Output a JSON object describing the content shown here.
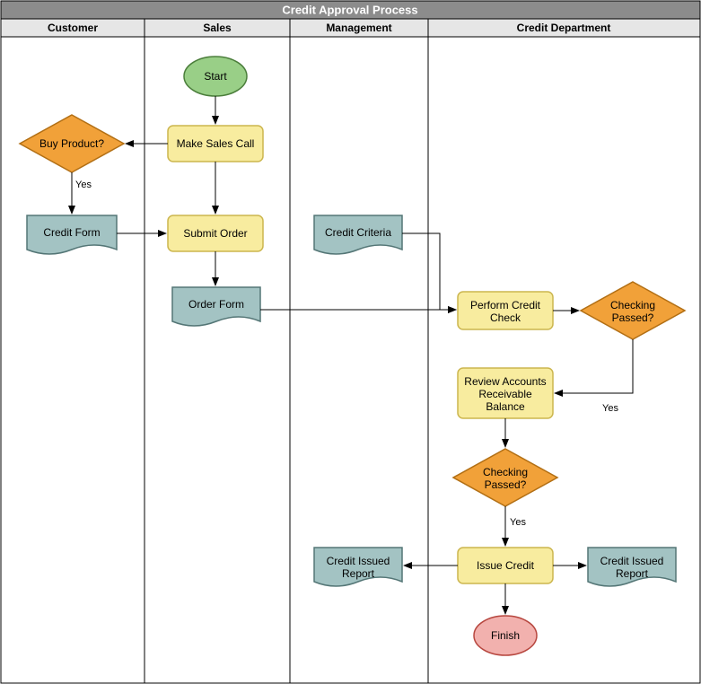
{
  "title": "Credit Approval Process",
  "lanes": [
    {
      "name": "Customer"
    },
    {
      "name": "Sales"
    },
    {
      "name": "Management"
    },
    {
      "name": "Credit Department"
    }
  ],
  "nodes": {
    "start": {
      "label": "Start"
    },
    "make_call": {
      "label": "Make Sales Call"
    },
    "buy": {
      "label": "Buy Product?"
    },
    "credit_form": {
      "label": "Credit Form"
    },
    "submit": {
      "label": "Submit Order"
    },
    "order_form": {
      "label": "Order Form"
    },
    "criteria": {
      "label": "Credit Criteria"
    },
    "perform": {
      "label1": "Perform Credit",
      "label2": "Check"
    },
    "check1": {
      "label1": "Checking",
      "label2": "Passed?"
    },
    "review": {
      "label1": "Review Accounts",
      "label2": "Receivable",
      "label3": "Balance"
    },
    "check2": {
      "label1": "Checking",
      "label2": "Passed?"
    },
    "issue": {
      "label": "Issue Credit"
    },
    "finish": {
      "label": "Finish"
    },
    "report_left": {
      "label1": "Credit Issued",
      "label2": "Report"
    },
    "report_right": {
      "label1": "Credit Issued",
      "label2": "Report"
    }
  },
  "edges": {
    "yes1": "Yes",
    "yes2": "Yes",
    "yes3": "Yes"
  },
  "chart_data": {
    "type": "swimlane-flowchart",
    "title": "Credit Approval Process",
    "lanes": [
      "Customer",
      "Sales",
      "Management",
      "Credit Department"
    ],
    "shapes": [
      {
        "id": "start",
        "lane": "Sales",
        "type": "terminator",
        "label": "Start"
      },
      {
        "id": "make_call",
        "lane": "Sales",
        "type": "process",
        "label": "Make Sales Call"
      },
      {
        "id": "buy",
        "lane": "Customer",
        "type": "decision",
        "label": "Buy Product?"
      },
      {
        "id": "credit_form",
        "lane": "Customer",
        "type": "document",
        "label": "Credit Form"
      },
      {
        "id": "submit",
        "lane": "Sales",
        "type": "process",
        "label": "Submit Order"
      },
      {
        "id": "order_form",
        "lane": "Sales",
        "type": "document",
        "label": "Order Form"
      },
      {
        "id": "criteria",
        "lane": "Management",
        "type": "document",
        "label": "Credit Criteria"
      },
      {
        "id": "perform",
        "lane": "Credit Department",
        "type": "process",
        "label": "Perform Credit Check"
      },
      {
        "id": "check1",
        "lane": "Credit Department",
        "type": "decision",
        "label": "Checking Passed?"
      },
      {
        "id": "review",
        "lane": "Credit Department",
        "type": "process",
        "label": "Review Accounts Receivable Balance"
      },
      {
        "id": "check2",
        "lane": "Credit Department",
        "type": "decision",
        "label": "Checking Passed?"
      },
      {
        "id": "issue",
        "lane": "Credit Department",
        "type": "process",
        "label": "Issue Credit"
      },
      {
        "id": "report_left",
        "lane": "Management",
        "type": "document",
        "label": "Credit Issued Report"
      },
      {
        "id": "report_right",
        "lane": "Credit Department",
        "type": "document",
        "label": "Credit Issued Report"
      },
      {
        "id": "finish",
        "lane": "Credit Department",
        "type": "terminator",
        "label": "Finish"
      }
    ],
    "edges": [
      {
        "from": "start",
        "to": "make_call"
      },
      {
        "from": "make_call",
        "to": "buy"
      },
      {
        "from": "buy",
        "to": "credit_form",
        "label": "Yes"
      },
      {
        "from": "make_call",
        "to": "submit"
      },
      {
        "from": "credit_form",
        "to": "submit"
      },
      {
        "from": "submit",
        "to": "order_form"
      },
      {
        "from": "order_form",
        "to": "perform"
      },
      {
        "from": "criteria",
        "to": "perform"
      },
      {
        "from": "perform",
        "to": "check1"
      },
      {
        "from": "check1",
        "to": "review",
        "label": "Yes"
      },
      {
        "from": "review",
        "to": "check2"
      },
      {
        "from": "check2",
        "to": "issue",
        "label": "Yes"
      },
      {
        "from": "issue",
        "to": "report_left"
      },
      {
        "from": "issue",
        "to": "report_right"
      },
      {
        "from": "issue",
        "to": "finish"
      }
    ]
  }
}
